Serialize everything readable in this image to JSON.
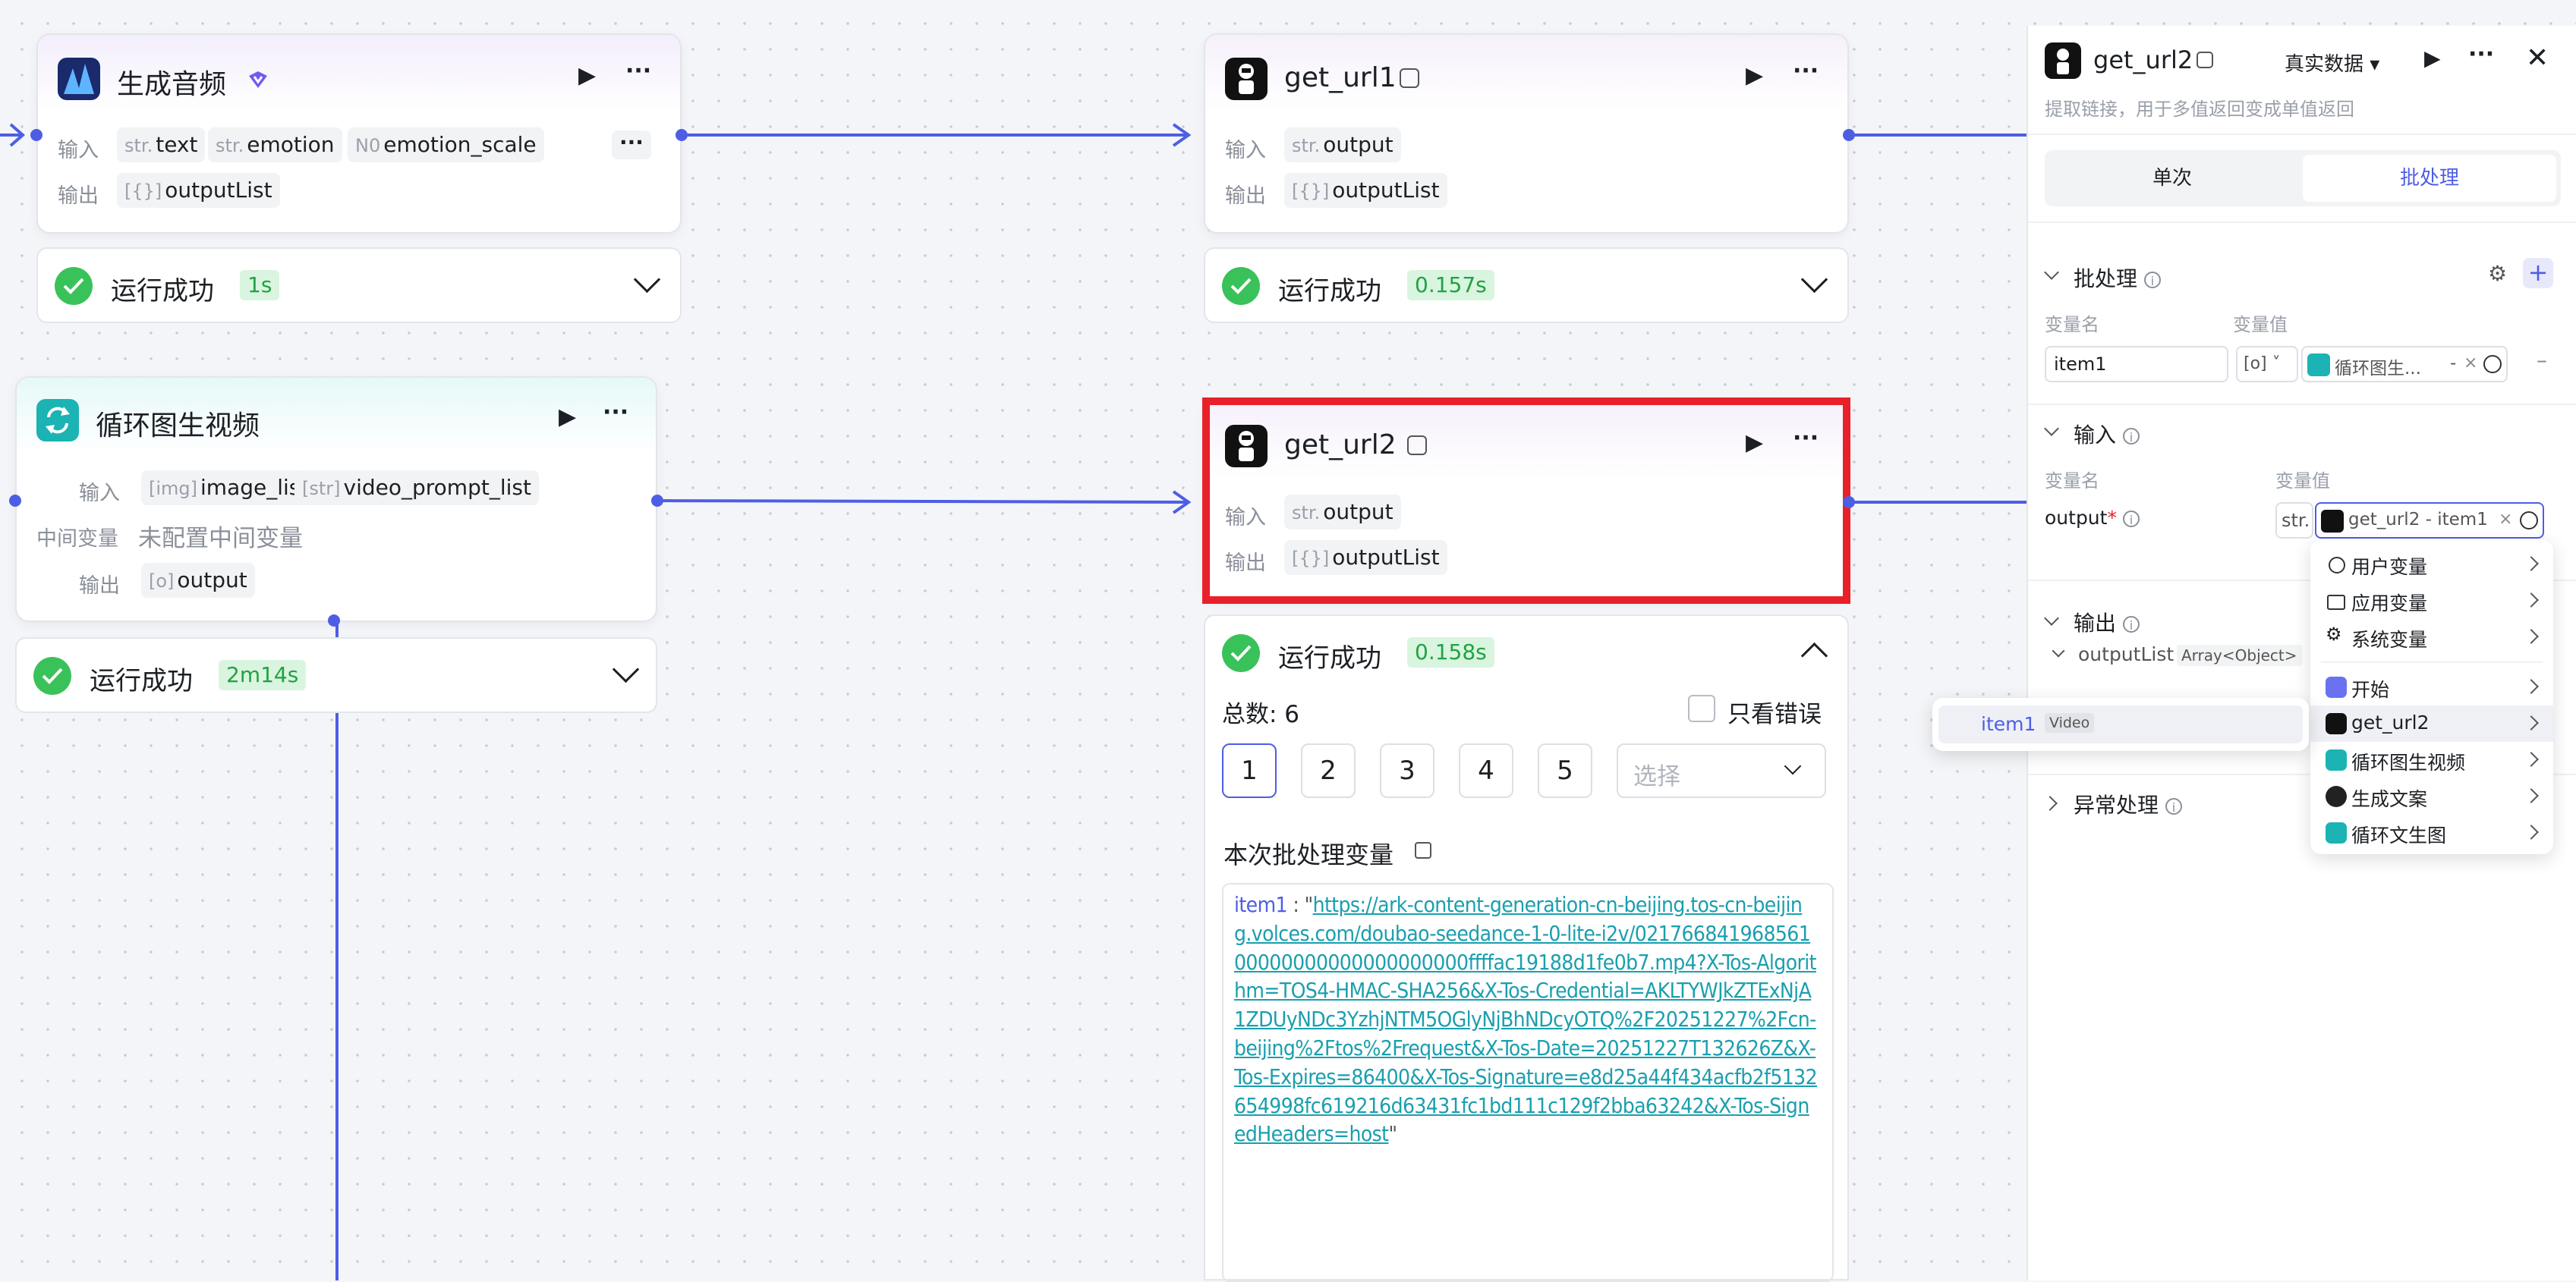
{
  "colors": {
    "accent": "#4e5ee4",
    "success": "#3ac25a",
    "highlight_border": "#e8202a",
    "link": "#1a9fae"
  },
  "nodes": {
    "audio": {
      "title": "生成音频",
      "input_label": "输入",
      "output_label": "输出",
      "inputs": [
        {
          "type": "str.",
          "name": "text"
        },
        {
          "type": "str.",
          "name": "emotion"
        },
        {
          "type": "N0",
          "name": "emotion_scale"
        }
      ],
      "outputs": [
        {
          "type": "[{}]",
          "name": "outputList"
        }
      ],
      "status": "运行成功",
      "duration": "1s"
    },
    "url1": {
      "title": "get_url1",
      "input_label": "输入",
      "output_label": "输出",
      "inputs": [
        {
          "type": "str.",
          "name": "output"
        }
      ],
      "outputs": [
        {
          "type": "[{}]",
          "name": "outputList"
        }
      ],
      "status": "运行成功",
      "duration": "0.157s"
    },
    "loop": {
      "title": "循环图生视频",
      "input_label": "输入",
      "mid_label": "中间变量",
      "mid_value": "未配置中间变量",
      "output_label": "输出",
      "inputs": [
        {
          "type": "[img]",
          "name": "image_list"
        },
        {
          "type": "[str]",
          "name": "video_prompt_list"
        }
      ],
      "outputs": [
        {
          "type": "[o]",
          "name": "output"
        }
      ],
      "status": "运行成功",
      "duration": "2m14s"
    },
    "url2": {
      "title": "get_url2",
      "input_label": "输入",
      "output_label": "输出",
      "inputs": [
        {
          "type": "str.",
          "name": "output"
        }
      ],
      "outputs": [
        {
          "type": "[{}]",
          "name": "outputList"
        }
      ],
      "status": "运行成功",
      "duration": "0.158s",
      "total": "总数: 6",
      "only_errors": "只看错误",
      "pages": [
        "1",
        "2",
        "3",
        "4",
        "5"
      ],
      "select_placeholder": "选择",
      "batch_var_title": "本次批处理变量",
      "item_key": "item1",
      "item_sep": " : \"",
      "item_url": "https://ark-content-generation-cn-beijing.tos-cn-beijing.volces.com/doubao-seedance-1-0-lite-i2v/02176684196856100000000000000000000ffffac19188d1fe0b7.mp4?X-Tos-Algorithm=TOS4-HMAC-SHA256&X-Tos-Credential=AKLTYWJkZTExNjA1ZDUyNDc3YzhjNTM5OGlyNjBhNDcyOTQ%2F20251227%2Fcn-beijing%2Ftos%2Frequest&X-Tos-Date=20251227T132626Z&X-Tos-Expires=86400&X-Tos-Signature=e8d25a44f434acfb2f5132654998fc619216d63431fc1bd111c129f2bba63242&X-Tos-SignedHeaders=host",
      "item_close": "\""
    }
  },
  "panel": {
    "title": "get_url2",
    "data_mode": "真实数据",
    "description": "提取链接，用于多值返回变成单值返回",
    "tabs": [
      "单次",
      "批处理"
    ],
    "batch_section": "批处理",
    "col_var_name": "变量名",
    "col_var_value": "变量值",
    "batch_var_name": "item1",
    "batch_value_tag": "循环图生...",
    "batch_value_tail": "-",
    "input_section": "输入",
    "input_col_name": "变量名",
    "input_col_value": "变量值",
    "input_var": "output",
    "input_required": "*",
    "input_type": "str.",
    "input_value_tag": "get_url2 - item1",
    "output_section": "输出",
    "output_var": "outputList",
    "output_type": "Array<Object>",
    "exception_section": "异常处理"
  },
  "dropdown": {
    "items": [
      {
        "icon": "user-icon",
        "label": "用户变量"
      },
      {
        "icon": "folder-icon",
        "label": "应用变量"
      },
      {
        "icon": "gear-icon",
        "label": "系统变量"
      },
      {
        "icon": "start-icon",
        "label": "开始"
      },
      {
        "icon": "robot-icon",
        "label": "get_url2"
      },
      {
        "icon": "loop-icon",
        "label": "循环图生视频"
      },
      {
        "icon": "chat-icon",
        "label": "生成文案"
      },
      {
        "icon": "loop-icon",
        "label": "循环文生图"
      }
    ]
  },
  "submenu": {
    "item": "item1",
    "type": "Video"
  }
}
